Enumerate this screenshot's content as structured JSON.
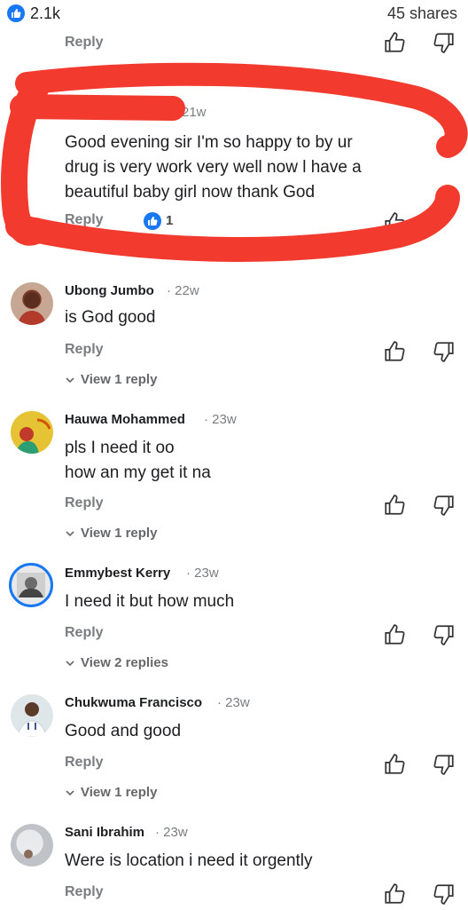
{
  "post": {
    "likes": "2.1k",
    "shares": "45 shares"
  },
  "actions": {
    "reply": "Reply"
  },
  "top_reply": {
    "label": "Reply"
  },
  "highlighted": {
    "time": "21w",
    "text_lines": [
      "Good evening sir I'm so happy to by ur",
      "drug is very work very well now l have a",
      "beautiful baby girl now thank God"
    ],
    "reply_label": "Reply",
    "like_count": "1"
  },
  "comments": [
    {
      "author": "Ubong Jumbo",
      "time": "22w",
      "text_lines": [
        "is God good"
      ],
      "reply_label": "Reply",
      "view_replies": "View 1 reply"
    },
    {
      "author": "Hauwa Mohammed",
      "time": "23w",
      "text_lines": [
        "pls I need it oo",
        "how an my get it na"
      ],
      "reply_label": "Reply",
      "view_replies": "View 1 reply"
    },
    {
      "author": "Emmybest Kerry",
      "time": "23w",
      "text_lines": [
        "I need it but how much"
      ],
      "reply_label": "Reply",
      "view_replies": "View 2 replies"
    },
    {
      "author": "Chukwuma Francisco",
      "time": "23w",
      "text_lines": [
        "Good and good"
      ],
      "reply_label": "Reply",
      "view_replies": "View 1 reply"
    },
    {
      "author": "Sani Ibrahim",
      "time": "23w",
      "text_lines": [
        "Were is location i need it orgently"
      ],
      "reply_label": "Reply"
    }
  ],
  "colors": {
    "accent": "#1877f2",
    "scribble": "#f23a2e"
  },
  "icons": [
    "like-icon",
    "dislike-icon",
    "chevron-down-icon"
  ]
}
